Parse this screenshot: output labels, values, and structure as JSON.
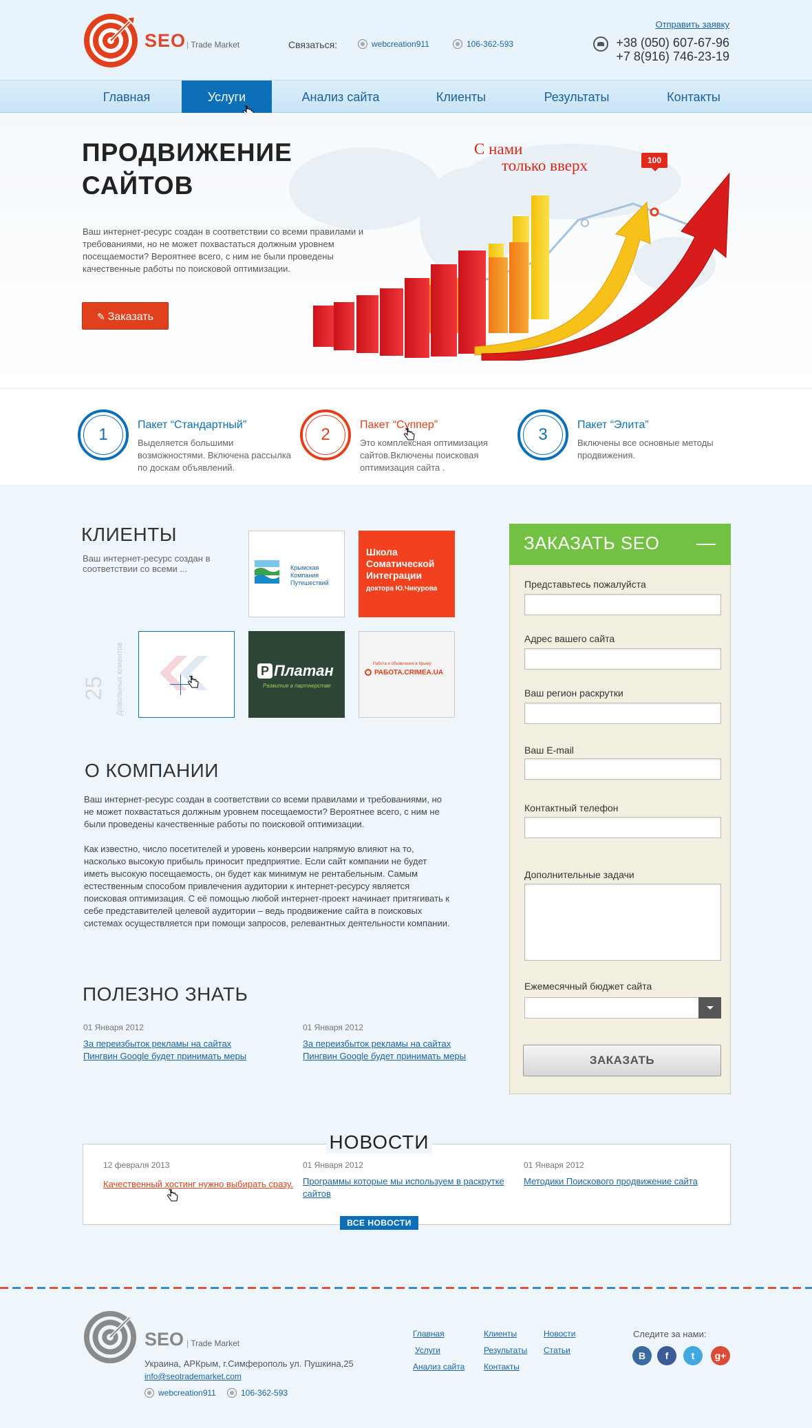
{
  "header": {
    "logo_text": "SEO",
    "logo_sub": "Trade Market",
    "contact_label": "Связаться:",
    "skype": "webcreation911",
    "icq": "106-362-593",
    "request_link": "Отправить заявку",
    "phone1": "+38 (050) 607-67-96",
    "phone2": "+7 8(916) 746-23-19"
  },
  "nav": {
    "items": [
      {
        "label": "Главная"
      },
      {
        "label": "Услуги",
        "active": true
      },
      {
        "label": "Анализ сайта"
      },
      {
        "label": "Клиенты"
      },
      {
        "label": "Результаты"
      },
      {
        "label": "Контакты"
      }
    ]
  },
  "hero": {
    "title_line1": "ПРОДВИЖЕНИЕ",
    "title_line2": "САЙТОВ",
    "text": "Ваш интернет-ресурс создан в соответствии со всеми правилами и требованиями, но не может похвастаться должным уровнем посещаемости? Вероятнее всего, с ним не были проведены качественные работы по поисковой оптимизации.",
    "order_button": "Заказать",
    "slogan_line1": "С нами",
    "slogan_line2": "только вверх",
    "badge": "100"
  },
  "packages": [
    {
      "number": "1",
      "title": "Пакет “Стандартный”",
      "desc": "Выделяется большими возможностями. Включена рассылка по доскам объявлений."
    },
    {
      "number": "2",
      "title": "Пакет “Суппер”",
      "desc": "Это комплексная оптимизация сайтов.Включены поисковая оптимизация сайта ."
    },
    {
      "number": "3",
      "title": "Пакет “Элита”",
      "desc": " Включены все основные методы продвижения."
    }
  ],
  "clients": {
    "title": "КЛИЕНТЫ",
    "text": "Ваш интернет-ресурс создан в соответствии со всеми ...",
    "count": "25",
    "count_label": "Довольных клиентов",
    "logos": {
      "crimea_travel": "Крымская Компания Путешествий",
      "school_line1": "Школа",
      "school_line2": "Соматической",
      "school_line3": "Интеграции",
      "school_line4": "доктора Ю.Чикурова",
      "platan": "Платан",
      "platan_sub": "Развитие в партнерстве",
      "rabota": "РАБОТА.CRIMEA.UA",
      "rabota_sub": "Работа и объявления в Крыму"
    }
  },
  "about": {
    "title": "О КОМПАНИИ",
    "p1": "Ваш интернет-ресурс создан в соответствии со всеми правилами и требованиями, но не может похвастаться должным уровнем посещаемости? Вероятнее всего, с ним не были проведены качественные работы по поисковой оптимизации.",
    "p2": "Как известно, число посетителей и уровень конверсии напрямую влияют на то, насколько высокую прибыль приносит предприятие. Если сайт компании не будет иметь высокую посещаемость, он будет как минимум не рентабельным. Самым естественным способом привлечения аудитории к интернет-ресурсу является поисковая оптимизация. С её помощью любой интернет-проект начинает притягивать к себе представителей целевой аудитории – ведь продвижение сайта в поисковых системах осуществляется при помощи запросов, релевантных деятельности компании."
  },
  "useful": {
    "title": "ПОЛЕЗНО ЗНАТЬ",
    "items": [
      {
        "date": "01 Января  2012",
        "link1": "За переизбыток рекламы на сайтах",
        "link2": "Пингвин Google будет принимать меры"
      },
      {
        "date": "01 Января  2012",
        "link1": "За переизбыток рекламы на сайтах",
        "link2": "Пингвин Google будет принимать меры"
      }
    ]
  },
  "form": {
    "title": "ЗАКАЗАТЬ SEO",
    "collapse": "—",
    "labels": {
      "name": "Представьтесь пожалуйста",
      "site": "Адрес вашего сайта",
      "region": "Ваш регион раскрутки",
      "email": "Ваш E-mail",
      "phone": "Контактный телефон",
      "tasks": "Дополнительные задачи",
      "budget": "Ежемесячный бюджет сайта"
    },
    "submit": "ЗАКАЗАТЬ"
  },
  "news": {
    "title": "НОВОСТИ",
    "items": [
      {
        "date": "12 февраля 2013",
        "link": "Качественный хостинг нужно выбирать сразу."
      },
      {
        "date": "01 Января  2012",
        "link": "Программы которые мы используем в раскрутке сайтов"
      },
      {
        "date": "01 Января  2012",
        "link": "Методики Поискового продвижение сайта"
      }
    ],
    "all_news": "ВСЕ НОВОСТИ"
  },
  "footer": {
    "logo_text": "SEO",
    "logo_sub": "Trade Market",
    "address": "Украина, АРКрым, г.Симферополь ул. Пушкина,25",
    "email": "info@seotrademarket.com",
    "skype": "webcreation911",
    "icq": "106-362-593",
    "links_col1": [
      "Главная",
      "Услуги",
      "Анализ сайта"
    ],
    "links_col2": [
      "Клиенты",
      "Результаты",
      "Контакты"
    ],
    "links_col3": [
      "Новости",
      "Статьи"
    ],
    "follow": "Следите за нами:",
    "social": [
      "В",
      "f",
      "t",
      "g+"
    ]
  },
  "colors": {
    "accent_blue": "#0d6fb8",
    "accent_red": "#e0401c",
    "form_green": "#72c143"
  }
}
